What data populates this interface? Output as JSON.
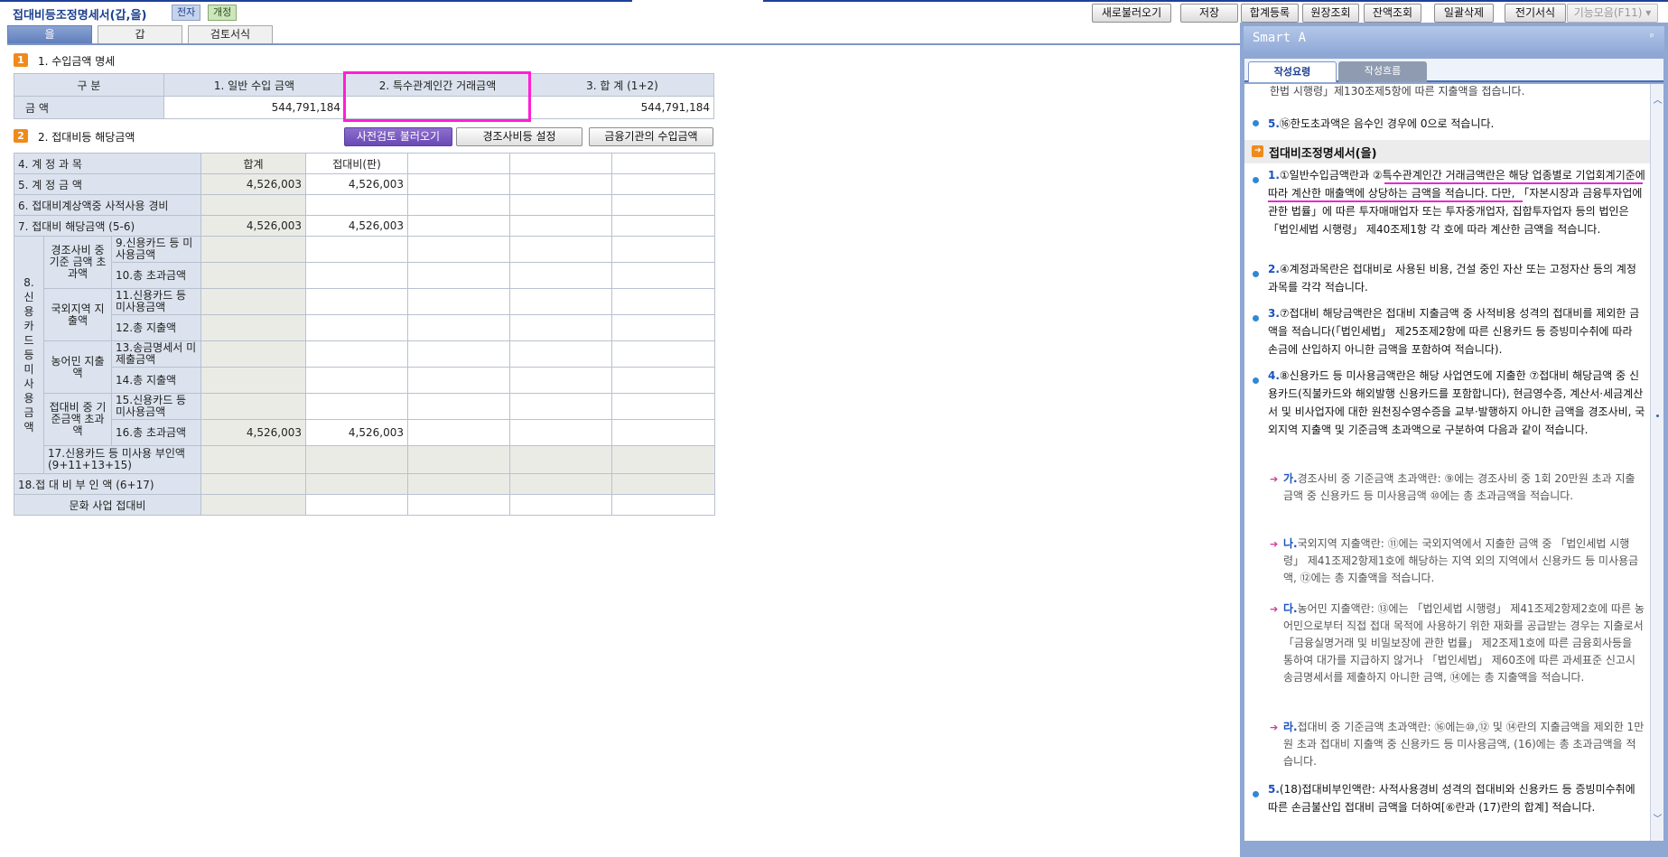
{
  "header": {
    "title": "접대비등조정명세서(갑,을)",
    "badge_e": "전자",
    "badge_rev": "개정",
    "buttons": [
      "새로불러오기",
      "저장",
      "합계등록",
      "원장조회",
      "잔액조회",
      "일괄삭제",
      "전기서식"
    ],
    "function_menu": "기능모음(F11) ▾"
  },
  "tabs": [
    "을",
    "갑",
    "검토서식"
  ],
  "section1": {
    "number": "1",
    "title": "1. 수입금액 명세",
    "headers": [
      "구      분",
      "1. 일반 수입 금액",
      "2. 특수관계인간 거래금액",
      "3. 합   계 (1+2)"
    ],
    "row_label": "금      액",
    "values": [
      "544,791,184",
      "",
      "544,791,184"
    ]
  },
  "section2": {
    "number": "2",
    "title": "2. 접대비등 해당금액",
    "buttons": {
      "pre_check": "사전검토 불러오기",
      "setting": "경조사비등 설정",
      "financial": "금융기관의 수입금액"
    },
    "col_head_label": "4. 계       정       과       목",
    "col_heads": [
      "합계",
      "접대비(판)",
      "",
      "",
      ""
    ],
    "rows": {
      "r5": {
        "label": "5. 계       정       금       액",
        "total": "4,526,003",
        "pan": "4,526,003"
      },
      "r6": {
        "label": "6. 접대비계상액중 사적사용 경비",
        "total": "",
        "pan": ""
      },
      "r7": {
        "label": "7. 접대비 해당금액 (5-6)",
        "total": "4,526,003",
        "pan": "4,526,003"
      },
      "r8_group": "8. 신 용 카 드 등 미 사 용 금 액",
      "g1": "경조사비 중 기준 금액 초과액",
      "r9": "9.신용카드 등 미사용금액",
      "r10": "10.총 초과금액",
      "g2": "국외지역 지출액",
      "r11": "11.신용카드 등 미사용금액",
      "r12": "12.총 지출액",
      "g3": "농어민 지출액",
      "r13": "13.송금명세서 미제출금액",
      "r14": "14.총 지출액",
      "g4": "접대비 중 기준금액 초과액",
      "r15": "15.신용카드 등 미사용금액",
      "r16": {
        "label": "16.총 초과금액",
        "total": "4,526,003",
        "pan": "4,526,003"
      },
      "r17": "17.신용카드 등 미사용 부인액 (9+11+13+15)",
      "r18": "18.접 대 비 부 인 액 (6+17)",
      "r_culture": "문화 사업 접대비"
    }
  },
  "smart": {
    "title": "Smart A",
    "pin": "ᵖ",
    "tabs": [
      "작성요령",
      "작성흐름"
    ],
    "top_line": "한법 시행령」제130조제5항에 따른 지출액을 접습니다.",
    "item5a_num": "5.",
    "item5a": "⑯한도초과액은 음수인 경우에 0으로 적습니다.",
    "section_title": "접대비조정명세서(을)",
    "items": [
      {
        "num": "1.",
        "text": "①일반수입금액란과 ②특수관계인간 거래금액란은 해당 업종별로 기업회계기준에 따라 계산한 매출액에 상당하는 금액을 적습니다. 다만, 「자본시장과 금융투자업에 관한 법률」에 따른 투자매매업자 또는 투자중개업자, 집합투자업자 등의 법인은「법인세법 시행령」 제40조제1항 각 호에 따라 계산한 금액을 적습니다."
      },
      {
        "num": "2.",
        "text": "④계정과목란은 접대비로 사용된 비용, 건설 중인 자산 또는 고정자산 등의 계정과목를 각각 적습니다."
      },
      {
        "num": "3.",
        "text": "⑦접대비 해당금액란은 접대비 지출금액 중 사적비용 성격의 접대비를 제외한 금액을 적습니다(「법인세법」 제25조제2항에 따른 신용카드 등 증빙미수취에 따라 손금에 산입하지 아니한 금액을 포함하여 적습니다)."
      },
      {
        "num": "4.",
        "text": "⑧신용카드 등 미사용금액란은 해당 사업연도에 지출한 ⑦접대비 해당금액 중 신용카드(직불카드와 해외발행 신용카드를 포함합니다), 현금영수증, 계산서·세금계산서 및 비사업자에 대한 원천징수영수증을 교부·발행하지 아니한 금액을 경조사비, 국외지역 지출액 및 기준금액 초과액으로 구분하여 다음과 같이 적습니다."
      }
    ],
    "subitems": [
      {
        "num": "가.",
        "text": "경조사비 중 기준금액 초과액란: ⑨에는 경조사비 중 1회 20만원 초과 지출금액 중 신용카드 등 미사용금액 ⑩에는 총 초과금액을 적습니다."
      },
      {
        "num": "나.",
        "text": "국외지역 지출액란: ⑪에는 국외지역에서 지출한 금액 중 「법인세법 시행령」 제41조제2항제1호에 해당하는 지역 외의 지역에서 신용카드 등 미사용금액, ⑫에는 총 지출액을 적습니다."
      },
      {
        "num": "다.",
        "text": "농어민 지출액란: ⑬에는 「법인세법 시행령」 제41조제2항제2호에 따른 농어민으로부터 직접 접대 목적에 사용하기 위한 재화를 공급받는 경우는 지출로서 「금융실명거래 및 비밀보장에 관한 법률」 제2조제1호에 따른 금융회사등을 통하여 대가를 지급하지 않거나 「법인세법」 제60조에 따른 과세표준 신고시 송금명세서를 제출하지 아니한 금액, ⑭에는 총 지출액을 적습니다."
      },
      {
        "num": "라.",
        "text": "접대비 중 기준금액 초과액란: ⑯에는⑩,⑫ 및 ⑭란의 지출금액을 제외한 1만원 초과 접대비 지출액 중 신용카드 등 미사용금액, (16)에는 총 초과금액을 적습니다."
      }
    ],
    "item5b_num": "5.",
    "item5b": "(18)접대비부인액란: 사적사용경비 성격의 접대비와 신용카드 등 증빙미수취에 따른 손금불산입 접대비 금액을 더하여[⑥란과 (17)란의 합계] 적습니다.",
    "colors": {
      "accent": "#1a52c0",
      "highlight": "#ff1fd3",
      "panel": "#8ea7d3"
    }
  }
}
